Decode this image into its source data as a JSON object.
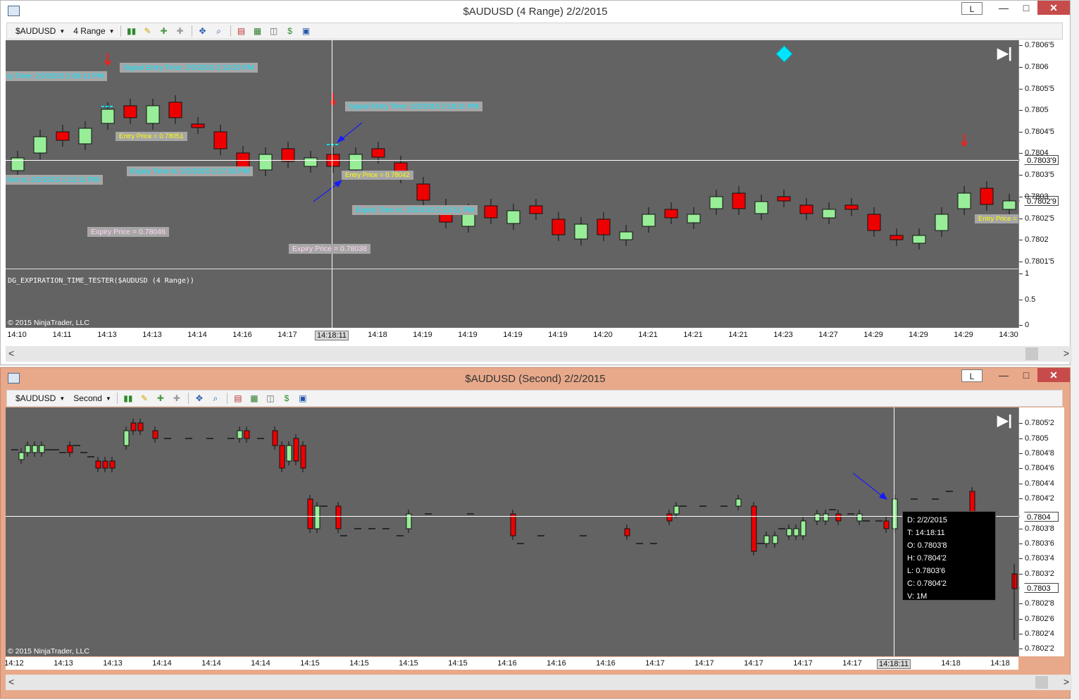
{
  "window1": {
    "title": "$AUDUSD (4 Range)  2/2/2015",
    "btn_l": "L",
    "btn_min": "—",
    "btn_max": "□",
    "btn_close": "✕",
    "instrument": "$AUDUSD",
    "period": "4 Range",
    "y_ticks": [
      [
        "0.7806'5",
        65
      ],
      [
        "0.7806",
        96
      ],
      [
        "0.7805'5",
        127
      ],
      [
        "0.7805",
        157
      ],
      [
        "0.7804'5",
        188
      ],
      [
        "0.7804",
        218
      ],
      [
        "0.7803'5",
        249
      ],
      [
        "0.7803",
        280
      ],
      [
        "0.7802'5",
        311
      ],
      [
        "0.7802",
        341
      ],
      [
        "0.7801'5",
        372
      ]
    ],
    "y_ticks_indicator": [
      [
        "1",
        389
      ],
      [
        "0.5",
        426
      ],
      [
        "0",
        462
      ]
    ],
    "price_box_1": "0.7803'9",
    "price_box_2": "0.7802'9",
    "x_labels": [
      [
        "14:10",
        24
      ],
      [
        "14:11",
        88
      ],
      [
        "14:13",
        152
      ],
      [
        "14:13",
        216
      ],
      [
        "14:14",
        280
      ],
      [
        "14:16",
        344
      ],
      [
        "14:17",
        408
      ],
      [
        "14:18:11",
        471
      ],
      [
        "14:18",
        536
      ],
      [
        "14:19",
        600
      ],
      [
        "14:19",
        664
      ],
      [
        "14:19",
        728
      ],
      [
        "14:19",
        792
      ],
      [
        "14:20",
        856
      ],
      [
        "14:21",
        920
      ],
      [
        "14:21",
        984
      ],
      [
        "14:21",
        1048
      ],
      [
        "14:23",
        1112
      ],
      [
        "14:27",
        1176
      ],
      [
        "14:29",
        1240
      ],
      [
        "14:29",
        1304
      ],
      [
        "14:29",
        1368
      ],
      [
        "14:30",
        1432
      ]
    ],
    "labels": {
      "sig1": "ry Time: 2/2/2015 2:08:11 PM",
      "sig2": "Signal Entry Time: 2/2/2015 2:13:20 PM",
      "sig3": "Signal Entry Time: 2/2/2015 2:18:11 PM",
      "entry1": "Entry Price = 0.78051",
      "entry2": "Entry Price = 0.78042",
      "entry3": "Entry Price =",
      "exp_time0": "ime Is: 2/2/2015 2:12:11 PM",
      "exp_time1": "Expiry Time Is: 2/2/2015 2:17:20 PM",
      "exp_time2": "Expiry Time Is: 2/2/2015 2:23:11 PM",
      "exp_price1": "Expiry Price = 0.78046",
      "exp_price2": "Expiry Price = 0.78038"
    },
    "indicator_label": "DG_EXPIRATION_TIME_TESTER($AUDUSD (4 Range))",
    "copyright": "© 2015 NinjaTrader, LLC"
  },
  "window2": {
    "title": "$AUDUSD (Second)  2/2/2015",
    "btn_l": "L",
    "btn_min": "—",
    "btn_max": "□",
    "btn_close": "✕",
    "instrument": "$AUDUSD",
    "period": "Second",
    "y_ticks": [
      [
        "0.7805'2",
        601
      ],
      [
        "0.7805",
        623
      ],
      [
        "0.7804'8",
        644
      ],
      [
        "0.7804'6",
        665
      ],
      [
        "0.7804'4",
        687
      ],
      [
        "0.7804'2",
        708
      ],
      [
        "0.7803'8",
        751
      ],
      [
        "0.7803'6",
        772
      ],
      [
        "0.7803'4",
        793
      ],
      [
        "0.7803'2",
        815
      ],
      [
        "0.7802'8",
        857
      ],
      [
        "0.7802'6",
        879
      ],
      [
        "0.7802'4",
        900
      ],
      [
        "0.7802'2",
        921
      ]
    ],
    "price_box_1": "0.7804",
    "price_box_2": "0.7803",
    "x_labels": [
      [
        "14:12",
        20
      ],
      [
        "14:13",
        90
      ],
      [
        "14:13",
        160
      ],
      [
        "14:14",
        230
      ],
      [
        "14:14",
        300
      ],
      [
        "14:14",
        370
      ],
      [
        "14:15",
        440
      ],
      [
        "14:15",
        510
      ],
      [
        "14:15",
        580
      ],
      [
        "14:15",
        650
      ],
      [
        "14:16",
        720
      ],
      [
        "14:16",
        790
      ],
      [
        "14:16",
        860
      ],
      [
        "14:17",
        930
      ],
      [
        "14:17",
        1000
      ],
      [
        "14:17",
        1070
      ],
      [
        "14:17",
        1140
      ],
      [
        "14:17",
        1210
      ],
      [
        "14:18:11",
        1269
      ],
      [
        "14:18",
        1350
      ],
      [
        "14:18",
        1420
      ]
    ],
    "tooltip": [
      "D: 2/2/2015",
      "T: 14:18:11",
      "O: 0.7803'8",
      "H: 0.7804'2",
      "L: 0.7803'6",
      "C: 0.7804'2",
      "V: 1M"
    ],
    "copyright": "© 2015 NinjaTrader, LLC"
  },
  "colors": {
    "chart_bg": "#636363",
    "up": "#98ee98",
    "down": "#ee0000",
    "signal": "#00e5ff",
    "arrow_blue": "#1a1aff"
  }
}
